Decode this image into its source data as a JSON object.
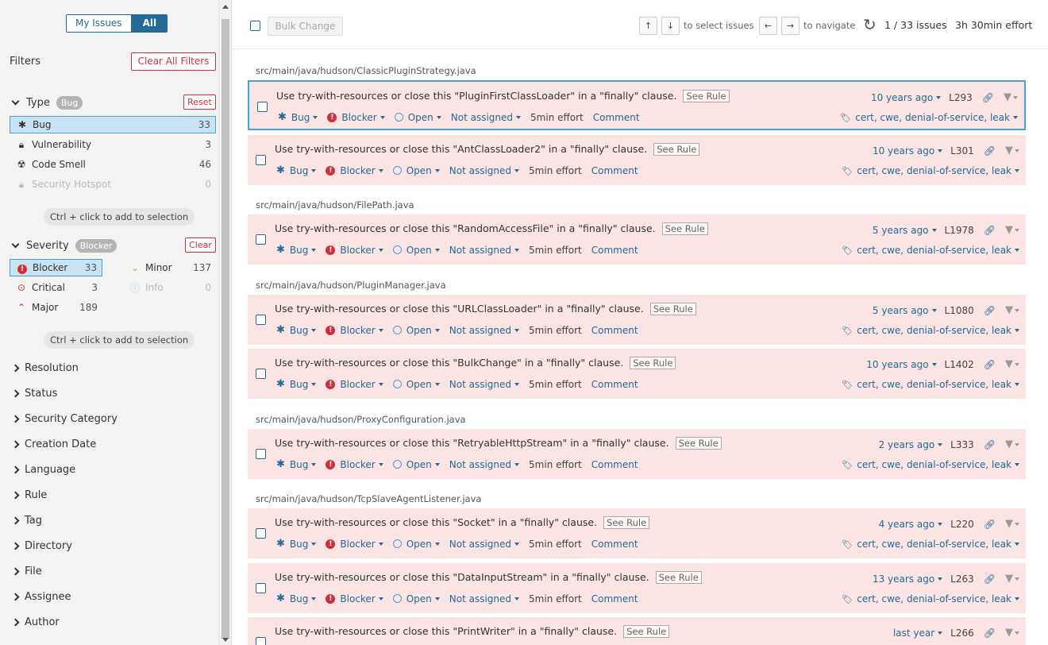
{
  "sidebar": {
    "toggle": {
      "my_issues": "My Issues",
      "all": "All"
    },
    "filters_title": "Filters",
    "clear_all": "Clear All Filters",
    "type": {
      "label": "Type",
      "badge": "Bug",
      "reset": "Reset",
      "items": [
        {
          "label": "Bug",
          "count": "33",
          "icon": "bug-icon"
        },
        {
          "label": "Vulnerability",
          "count": "3",
          "icon": "lock-icon"
        },
        {
          "label": "Code Smell",
          "count": "46",
          "icon": "code-smell-icon"
        },
        {
          "label": "Security Hotspot",
          "count": "0",
          "icon": "lock-icon"
        }
      ],
      "hint": "Ctrl + click to add to selection"
    },
    "severity": {
      "label": "Severity",
      "badge": "Blocker",
      "clear": "Clear",
      "items": [
        {
          "label": "Blocker",
          "count": "33"
        },
        {
          "label": "Critical",
          "count": "3"
        },
        {
          "label": "Major",
          "count": "189"
        },
        {
          "label": "Minor",
          "count": "137"
        },
        {
          "label": "Info",
          "count": "0"
        }
      ],
      "hint": "Ctrl + click to add to selection"
    },
    "collapsed": [
      "Resolution",
      "Status",
      "Security Category",
      "Creation Date",
      "Language",
      "Rule",
      "Tag",
      "Directory",
      "File",
      "Assignee",
      "Author"
    ]
  },
  "toolbar": {
    "bulk_change": "Bulk Change",
    "up": "↑",
    "down": "↓",
    "select_text": "to select issues",
    "left": "←",
    "right": "→",
    "navigate_text": "to navigate",
    "count": "1 / 33 issues",
    "effort": "3h 30min effort"
  },
  "issue_common": {
    "type": "Bug",
    "severity": "Blocker",
    "status": "Open",
    "assignee": "Not assigned",
    "effort": "5min effort",
    "comment": "Comment",
    "tags": "cert, cwe, denial-of-service, leak",
    "see_rule": "See Rule"
  },
  "files": [
    "src/main/java/hudson/ClassicPluginStrategy.java",
    "src/main/java/hudson/FilePath.java",
    "src/main/java/hudson/PluginManager.java",
    "src/main/java/hudson/ProxyConfiguration.java",
    "src/main/java/hudson/TcpSlaveAgentListener.java"
  ],
  "issues": [
    {
      "message": "Use try-with-resources or close this \"PluginFirstClassLoader\" in a \"finally\" clause.",
      "age": "10 years ago",
      "line": "L293"
    },
    {
      "message": "Use try-with-resources or close this \"AntClassLoader2\" in a \"finally\" clause.",
      "age": "10 years ago",
      "line": "L301"
    },
    {
      "message": "Use try-with-resources or close this \"RandomAccessFile\" in a \"finally\" clause.",
      "age": "5 years ago",
      "line": "L1978"
    },
    {
      "message": "Use try-with-resources or close this \"URLClassLoader\" in a \"finally\" clause.",
      "age": "5 years ago",
      "line": "L1080"
    },
    {
      "message": "Use try-with-resources or close this \"BulkChange\" in a \"finally\" clause.",
      "age": "10 years ago",
      "line": "L1402"
    },
    {
      "message": "Use try-with-resources or close this \"RetryableHttpStream\" in a \"finally\" clause.",
      "age": "2 years ago",
      "line": "L333"
    },
    {
      "message": "Use try-with-resources or close this \"Socket\" in a \"finally\" clause.",
      "age": "4 years ago",
      "line": "L220"
    },
    {
      "message": "Use try-with-resources or close this \"DataInputStream\" in a \"finally\" clause.",
      "age": "13 years ago",
      "line": "L263"
    },
    {
      "message": "Use try-with-resources or close this \"PrintWriter\" in a \"finally\" clause.",
      "age": "last year",
      "line": "L266"
    }
  ]
}
